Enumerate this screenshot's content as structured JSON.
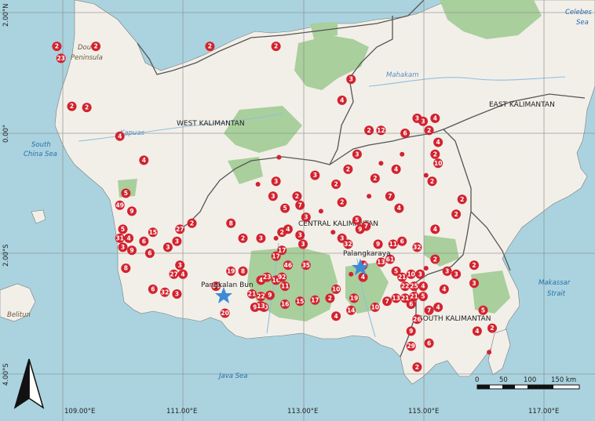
{
  "regions": {
    "west_kalimantan": "WEST KALIMANTAN",
    "central_kalimantan": "CENTRAL KALIMANTAN",
    "east_kalimantan": "EAST KALIMANTAN",
    "south_kalimantan": "SOUTH KALIMANTAN"
  },
  "seas": {
    "south_china_sea": [
      "South",
      "China Sea"
    ],
    "java_sea": "Java Sea",
    "makassar_strait": [
      "Makassar",
      "Strait"
    ],
    "celebes_sea": [
      "Celebes",
      "Sea"
    ]
  },
  "places": {
    "dou_peninsula": [
      "Dou",
      "Peninsula"
    ],
    "belitung": "Belitun",
    "kapuas": "Kapuas",
    "mahakam": "Mahakam"
  },
  "cities": {
    "pangkalan_bun": "Pangkalan Bun",
    "palangkaraya": "Palangkaraya"
  },
  "axes": {
    "x_ticks": [
      "109.00°E",
      "111.00°E",
      "113.00°E",
      "115.00°E",
      "117.00°E"
    ],
    "y_ticks": [
      "2.00°N",
      "0.00°",
      "2.00°S",
      "4.00°S"
    ]
  },
  "scale_bar": {
    "labels": [
      "0",
      "50",
      "100",
      "150 km"
    ]
  },
  "colors": {
    "sea": "#aad3df",
    "land": "#f2efe9",
    "forest": "#a9cf9c",
    "marker": "#d2232f",
    "city_star": "#3d8bd6",
    "province_border": "#555555"
  },
  "markers": [
    {
      "lon": 108.9,
      "lat": 1.45,
      "count": "2"
    },
    {
      "lon": 109.55,
      "lat": 1.45,
      "count": "2"
    },
    {
      "lon": 108.97,
      "lat": 1.25,
      "count": "23"
    },
    {
      "lon": 109.15,
      "lat": 0.45,
      "count": "2"
    },
    {
      "lon": 109.4,
      "lat": 0.43,
      "count": "2"
    },
    {
      "lon": 111.45,
      "lat": 1.45,
      "count": "2"
    },
    {
      "lon": 112.55,
      "lat": 1.45,
      "count": "2"
    },
    {
      "lon": 113.8,
      "lat": 0.9,
      "count": "3"
    },
    {
      "lon": 113.65,
      "lat": 0.55,
      "count": "4"
    },
    {
      "lon": 109.95,
      "lat": -0.05,
      "count": "4"
    },
    {
      "lon": 110.35,
      "lat": -0.45,
      "count": "4"
    },
    {
      "lon": 110.05,
      "lat": -1.0,
      "count": "5"
    },
    {
      "lon": 110.15,
      "lat": -1.3,
      "count": "9"
    },
    {
      "lon": 109.95,
      "lat": -1.2,
      "count": "49"
    },
    {
      "lon": 110.0,
      "lat": -1.6,
      "count": "5"
    },
    {
      "lon": 110.5,
      "lat": -1.65,
      "count": "15"
    },
    {
      "lon": 110.35,
      "lat": -1.8,
      "count": "6"
    },
    {
      "lon": 109.95,
      "lat": -1.75,
      "count": "31"
    },
    {
      "lon": 110.1,
      "lat": -1.75,
      "count": "4"
    },
    {
      "lon": 110.0,
      "lat": -1.9,
      "count": "3"
    },
    {
      "lon": 110.15,
      "lat": -1.95,
      "count": "9"
    },
    {
      "lon": 110.45,
      "lat": -2.0,
      "count": "6"
    },
    {
      "lon": 110.75,
      "lat": -1.9,
      "count": "3"
    },
    {
      "lon": 110.95,
      "lat": -1.6,
      "count": "27"
    },
    {
      "lon": 111.15,
      "lat": -1.5,
      "count": "2"
    },
    {
      "lon": 110.9,
      "lat": -1.8,
      "count": "3"
    },
    {
      "lon": 110.05,
      "lat": -2.25,
      "count": "8"
    },
    {
      "lon": 110.85,
      "lat": -2.35,
      "count": "27"
    },
    {
      "lon": 111.0,
      "lat": -2.35,
      "count": "4"
    },
    {
      "lon": 110.95,
      "lat": -2.2,
      "count": "3"
    },
    {
      "lon": 110.5,
      "lat": -2.6,
      "count": "6"
    },
    {
      "lon": 110.7,
      "lat": -2.65,
      "count": "32"
    },
    {
      "lon": 110.9,
      "lat": -2.68,
      "count": "3"
    },
    {
      "lon": 111.55,
      "lat": -2.55,
      "count": "66"
    },
    {
      "lon": 111.7,
      "lat": -3.0,
      "count": "20"
    },
    {
      "lon": 111.8,
      "lat": -2.3,
      "count": "19"
    },
    {
      "lon": 111.8,
      "lat": -1.5,
      "count": "8"
    },
    {
      "lon": 112.0,
      "lat": -1.75,
      "count": "2"
    },
    {
      "lon": 112.3,
      "lat": -1.75,
      "count": "3"
    },
    {
      "lon": 112.55,
      "lat": -1.75,
      "count": "1"
    },
    {
      "lon": 112.65,
      "lat": -1.65,
      "count": "2"
    },
    {
      "lon": 112.75,
      "lat": -1.6,
      "count": "4"
    },
    {
      "lon": 112.95,
      "lat": -1.7,
      "count": "3"
    },
    {
      "lon": 113.05,
      "lat": -1.4,
      "count": "3"
    },
    {
      "lon": 112.7,
      "lat": -1.25,
      "count": "5"
    },
    {
      "lon": 112.5,
      "lat": -1.05,
      "count": "3"
    },
    {
      "lon": 112.95,
      "lat": -1.2,
      "count": "7"
    },
    {
      "lon": 112.9,
      "lat": -1.05,
      "count": "2"
    },
    {
      "lon": 112.55,
      "lat": -2.05,
      "count": "17"
    },
    {
      "lon": 112.65,
      "lat": -1.95,
      "count": "17"
    },
    {
      "lon": 112.75,
      "lat": -2.2,
      "count": "46"
    },
    {
      "lon": 112.0,
      "lat": -2.3,
      "count": "8"
    },
    {
      "lon": 112.3,
      "lat": -2.45,
      "count": "4"
    },
    {
      "lon": 112.4,
      "lat": -2.4,
      "count": "23"
    },
    {
      "lon": 112.55,
      "lat": -2.45,
      "count": "16"
    },
    {
      "lon": 112.65,
      "lat": -2.4,
      "count": "92"
    },
    {
      "lon": 112.7,
      "lat": -2.55,
      "count": "11"
    },
    {
      "lon": 112.15,
      "lat": -2.68,
      "count": "21"
    },
    {
      "lon": 112.3,
      "lat": -2.72,
      "count": "22"
    },
    {
      "lon": 112.45,
      "lat": -2.7,
      "count": "9"
    },
    {
      "lon": 112.35,
      "lat": -2.9,
      "count": "10"
    },
    {
      "lon": 112.7,
      "lat": -2.85,
      "count": "16"
    },
    {
      "lon": 112.2,
      "lat": -2.9,
      "count": "9"
    },
    {
      "lon": 112.3,
      "lat": -2.88,
      "count": "13"
    },
    {
      "lon": 113.05,
      "lat": -2.2,
      "count": "35"
    },
    {
      "lon": 113.0,
      "lat": -1.85,
      "count": "3"
    },
    {
      "lon": 112.95,
      "lat": -2.8,
      "count": "15"
    },
    {
      "lon": 113.2,
      "lat": -2.78,
      "count": "17"
    },
    {
      "lon": 113.45,
      "lat": -2.75,
      "count": "2"
    },
    {
      "lon": 113.55,
      "lat": -2.6,
      "count": "10"
    },
    {
      "lon": 113.55,
      "lat": -3.05,
      "count": "4"
    },
    {
      "lon": 113.85,
      "lat": -2.75,
      "count": "19"
    },
    {
      "lon": 113.8,
      "lat": -2.95,
      "count": "14"
    },
    {
      "lon": 114.0,
      "lat": -2.4,
      "count": "4"
    },
    {
      "lon": 114.0,
      "lat": -2.2,
      "count": "16"
    },
    {
      "lon": 113.8,
      "lat": -2.35,
      "count": "1"
    },
    {
      "lon": 114.3,
      "lat": -2.15,
      "count": "13"
    },
    {
      "lon": 113.95,
      "lat": -1.6,
      "count": "9"
    },
    {
      "lon": 113.5,
      "lat": -1.65,
      "count": "1"
    },
    {
      "lon": 113.65,
      "lat": -1.75,
      "count": "3"
    },
    {
      "lon": 113.75,
      "lat": -1.85,
      "count": "32"
    },
    {
      "lon": 113.9,
      "lat": -1.45,
      "count": "5"
    },
    {
      "lon": 114.05,
      "lat": -1.55,
      "count": "7"
    },
    {
      "lon": 114.25,
      "lat": -1.85,
      "count": "9"
    },
    {
      "lon": 114.5,
      "lat": -1.85,
      "count": "11"
    },
    {
      "lon": 114.65,
      "lat": -1.8,
      "count": "6"
    },
    {
      "lon": 114.9,
      "lat": -1.9,
      "count": "32"
    },
    {
      "lon": 114.45,
      "lat": -2.1,
      "count": "61"
    },
    {
      "lon": 114.55,
      "lat": -2.3,
      "count": "5"
    },
    {
      "lon": 114.65,
      "lat": -2.4,
      "count": "21"
    },
    {
      "lon": 114.8,
      "lat": -2.35,
      "count": "10"
    },
    {
      "lon": 114.95,
      "lat": -2.35,
      "count": "3"
    },
    {
      "lon": 115.05,
      "lat": -2.25,
      "count": "1"
    },
    {
      "lon": 114.7,
      "lat": -2.55,
      "count": "22"
    },
    {
      "lon": 114.85,
      "lat": -2.55,
      "count": "25"
    },
    {
      "lon": 114.7,
      "lat": -2.75,
      "count": "21"
    },
    {
      "lon": 114.85,
      "lat": -2.72,
      "count": "21"
    },
    {
      "lon": 115.0,
      "lat": -2.55,
      "count": "4"
    },
    {
      "lon": 115.0,
      "lat": -2.72,
      "count": "5"
    },
    {
      "lon": 114.8,
      "lat": -2.85,
      "count": "6"
    },
    {
      "lon": 115.1,
      "lat": -2.95,
      "count": "7"
    },
    {
      "lon": 114.9,
      "lat": -3.1,
      "count": "26"
    },
    {
      "lon": 114.55,
      "lat": -2.75,
      "count": "13"
    },
    {
      "lon": 114.4,
      "lat": -2.8,
      "count": "7"
    },
    {
      "lon": 114.2,
      "lat": -2.9,
      "count": "10"
    },
    {
      "lon": 114.8,
      "lat": -3.3,
      "count": "9"
    },
    {
      "lon": 114.8,
      "lat": -3.55,
      "count": "29"
    },
    {
      "lon": 115.1,
      "lat": -3.5,
      "count": "6"
    },
    {
      "lon": 114.9,
      "lat": -3.9,
      "count": "2"
    },
    {
      "lon": 115.2,
      "lat": -2.1,
      "count": "2"
    },
    {
      "lon": 115.4,
      "lat": -2.3,
      "count": "3"
    },
    {
      "lon": 115.55,
      "lat": -2.35,
      "count": "3"
    },
    {
      "lon": 115.35,
      "lat": -2.6,
      "count": "4"
    },
    {
      "lon": 115.25,
      "lat": -2.9,
      "count": "4"
    },
    {
      "lon": 115.85,
      "lat": -2.2,
      "count": "2"
    },
    {
      "lon": 115.85,
      "lat": -2.5,
      "count": "3"
    },
    {
      "lon": 116.0,
      "lat": -2.95,
      "count": "5"
    },
    {
      "lon": 115.9,
      "lat": -3.3,
      "count": "4"
    },
    {
      "lon": 116.15,
      "lat": -3.25,
      "count": "2"
    },
    {
      "lon": 116.1,
      "lat": -3.65,
      "count": "1"
    },
    {
      "lon": 115.65,
      "lat": -1.1,
      "count": "2"
    },
    {
      "lon": 115.55,
      "lat": -1.35,
      "count": "2"
    },
    {
      "lon": 115.2,
      "lat": -1.6,
      "count": "4"
    },
    {
      "lon": 115.05,
      "lat": -0.7,
      "count": "1"
    },
    {
      "lon": 115.15,
      "lat": -0.8,
      "count": "2"
    },
    {
      "lon": 115.2,
      "lat": -0.35,
      "count": "2"
    },
    {
      "lon": 115.25,
      "lat": -0.5,
      "count": "10"
    },
    {
      "lon": 115.25,
      "lat": -0.15,
      "count": "4"
    },
    {
      "lon": 115.1,
      "lat": 0.05,
      "count": "2"
    },
    {
      "lon": 115.0,
      "lat": 0.2,
      "count": "3"
    },
    {
      "lon": 115.2,
      "lat": 0.25,
      "count": "4"
    },
    {
      "lon": 114.9,
      "lat": 0.25,
      "count": "3"
    },
    {
      "lon": 114.7,
      "lat": 0.0,
      "count": "6"
    },
    {
      "lon": 114.3,
      "lat": 0.05,
      "count": "12"
    },
    {
      "lon": 114.1,
      "lat": 0.05,
      "count": "2"
    },
    {
      "lon": 114.65,
      "lat": -0.35,
      "count": "1"
    },
    {
      "lon": 113.9,
      "lat": -0.35,
      "count": "3"
    },
    {
      "lon": 113.75,
      "lat": -0.6,
      "count": "2"
    },
    {
      "lon": 114.3,
      "lat": -0.5,
      "count": "1"
    },
    {
      "lon": 114.2,
      "lat": -0.75,
      "count": "2"
    },
    {
      "lon": 114.55,
      "lat": -0.6,
      "count": "4"
    },
    {
      "lon": 114.45,
      "lat": -1.05,
      "count": "7"
    },
    {
      "lon": 114.6,
      "lat": -1.25,
      "count": "4"
    },
    {
      "lon": 114.1,
      "lat": -1.05,
      "count": "1"
    },
    {
      "lon": 113.65,
      "lat": -1.15,
      "count": "2"
    },
    {
      "lon": 113.2,
      "lat": -0.7,
      "count": "3"
    },
    {
      "lon": 113.55,
      "lat": -0.85,
      "count": "2"
    },
    {
      "lon": 112.55,
      "lat": -0.8,
      "count": "3"
    },
    {
      "lon": 112.25,
      "lat": -0.85,
      "count": "1"
    },
    {
      "lon": 113.3,
      "lat": -1.3,
      "count": "1"
    },
    {
      "lon": 112.6,
      "lat": -0.4,
      "count": "1"
    }
  ]
}
